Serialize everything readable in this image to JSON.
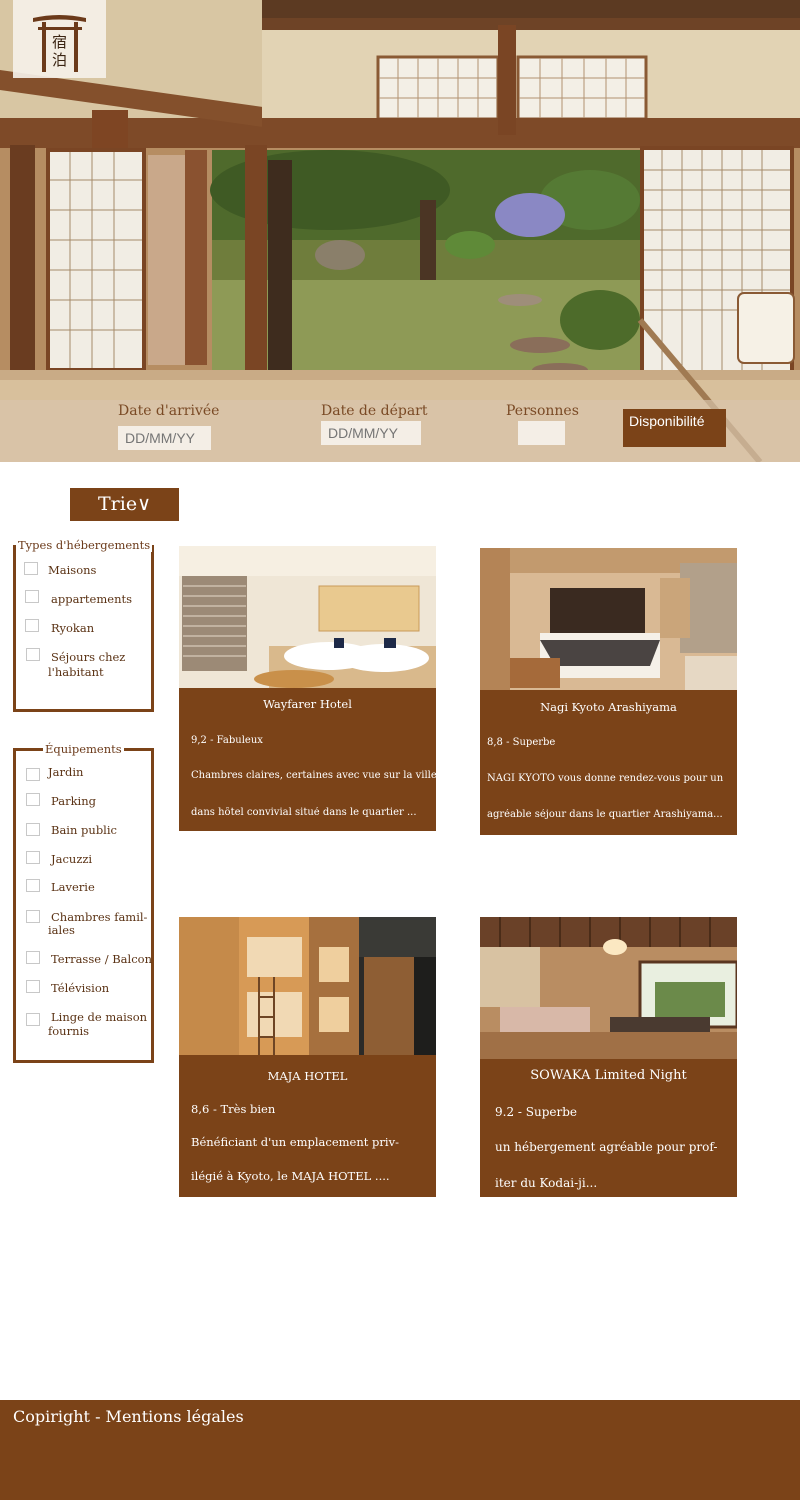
{
  "logo": {
    "char1": "宿",
    "char2": "泊"
  },
  "search": {
    "arrival_label": "Date d'arrivée",
    "arrival_placeholder": "DD/MM/YY",
    "departure_label": "Date de départ",
    "departure_placeholder": "DD/MM/YY",
    "persons_label": "Personnes",
    "persons_value": "",
    "availability_button": "Disponibilité"
  },
  "sort": {
    "label": "Trie∨"
  },
  "filters": {
    "types": {
      "title": "Types d'hébergements",
      "items": [
        "Maisons",
        "appartements",
        "Ryokan",
        "Séjours chez",
        "l'habitant"
      ]
    },
    "equipments": {
      "title": "Équipements",
      "items": [
        "Jardin",
        "Parking",
        "Bain public",
        "Jacuzzi",
        "Laverie",
        "Chambres famil-",
        "iales",
        "Terrasse / Balcon",
        "Télévision",
        "Linge de maison",
        "fournis"
      ]
    }
  },
  "hotels": [
    {
      "name": "Wayfarer Hotel",
      "rating": "9,2 - Fabuleux",
      "desc_line1": "Chambres claires, certaines avec vue sur la ville,",
      "desc_line2": "dans hôtel convivial situé dans le quartier ..."
    },
    {
      "name": "Nagi Kyoto Arashiyama",
      "rating": "8,8 - Superbe",
      "desc_line1": "NAGI KYOTO vous donne rendez-vous pour un",
      "desc_line2": "agréable séjour dans le quartier Arashiyama..."
    },
    {
      "name": "MAJA HOTEL",
      "rating": "8,6 - Très bien",
      "desc_line1": "Bénéficiant d'un emplacement priv-",
      "desc_line2": "ilégié à Kyoto, le MAJA HOTEL ...."
    },
    {
      "name": "SOWAKA Limited Night",
      "rating": "9.2 - Superbe",
      "desc_line1": "un hébergement agréable pour prof-",
      "desc_line2": "iter du Kodai-ji..."
    }
  ],
  "footer": {
    "text": "Copiright - Mentions légales"
  },
  "colors": {
    "brand": "#7b4318",
    "text": "#6b3a1a"
  }
}
